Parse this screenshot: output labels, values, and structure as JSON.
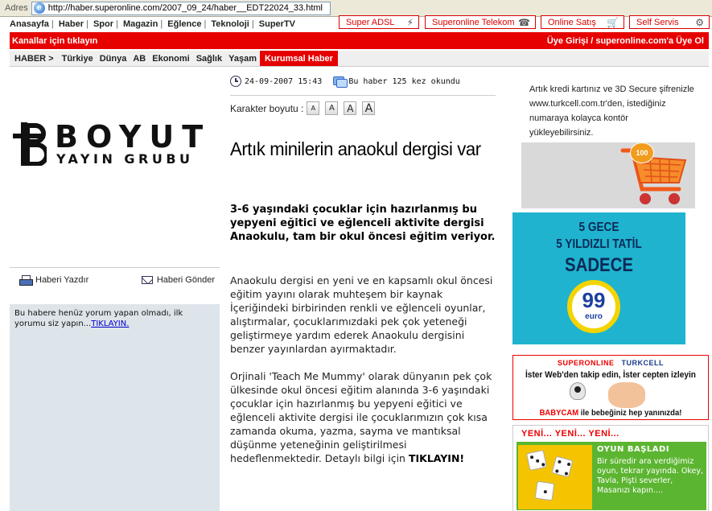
{
  "browser": {
    "address_label": "Adres",
    "url": "http://haber.superonline.com/2007_09_24/haber__EDT22024_33.html"
  },
  "service_tabs": [
    {
      "label": "Super ADSL",
      "icon": "lightning-icon"
    },
    {
      "label": "Superonline Telekom",
      "icon": "phone-icon"
    },
    {
      "label": "Online Satış",
      "icon": "cart-icon"
    },
    {
      "label": "Self Servis",
      "icon": "gear-icon"
    }
  ],
  "main_nav": [
    "Anasayfa",
    "Haber",
    "Spor",
    "Magazin",
    "Eğlence",
    "Teknoloji",
    "SuperTV"
  ],
  "red_bar": {
    "left": "Kanallar için tıklayın",
    "right": "Üye Girişi / superonline.com'a Üye Ol"
  },
  "sub_nav": {
    "head": "HABER >",
    "items": [
      "Türkiye",
      "Dünya",
      "AB",
      "Ekonomi",
      "Sağlık",
      "Yaşam"
    ],
    "active": "Kurumsal Haber"
  },
  "logo": {
    "line1": "BOYUT",
    "line2": "YAYIN GRUBU"
  },
  "tools": {
    "print": "Haberi Yazdır",
    "send": "Haberi Gönder"
  },
  "comments": {
    "text": "Bu habere henüz yorum yapan olmadı, ilk yorumu siz yapın...",
    "link": "TIKLAYIN."
  },
  "article": {
    "date": "24-09-2007 15:43",
    "views": "Bu haber 125 kez okundu",
    "font_size_label": "Karakter boyutu :",
    "font_buttons": [
      "A",
      "A",
      "A",
      "A"
    ],
    "title": "Artık minilerin anaokul dergisi var",
    "lead": "3-6 yaşındaki çocuklar için hazırlanmış bu yepyeni eğitici ve eğlenceli aktivite dergisi Anaokulu, tam bir okul öncesi eğitim veriyor.",
    "p1": "Anaokulu dergisi en yeni ve en kapsamlı okul öncesi eğitim yayını olarak muhteşem bir kaynak İçeriğindeki birbirinden renkli ve eğlenceli oyunlar, alıştırmalar, çocuklarımızdaki pek çok yeteneği geliştirmeye yardım ederek Anaokulu dergisini benzer yayınlardan ayırmaktadır.",
    "p2": "Orjinali 'Teach Me Mummy' olarak dünyanın pek çok ülkesinde okul öncesi eğitim alanında 3-6 yaşındaki çocuklar için hazırlanmış bu yepyeni eğitici ve eğlenceli aktivite dergisi ile çocuklarımızın çok kısa zamanda okuma, yazma, sayma ve mantıksal düşünme yeteneğinin geliştirilmesi hedeflenmektedir. Detaylı bilgi için",
    "p2_link": "TIKLAYIN!"
  },
  "ads": {
    "turkcell_text": "Artık kredi kartınız ve 3D Secure şifrenizle www.turkcell.com.tr'den, istediğiniz numaraya kolayca kontör yükleyebilirsiniz.",
    "badge": "100",
    "tatil_l1": "5 GECE",
    "tatil_l2": "5 YILDIZLI TATİL",
    "tatil_l3": "SADECE",
    "tatil_price": "99",
    "tatil_unit": "euro",
    "sol_brand1": "SUPERONLINE",
    "sol_brand2": "TURKCELL",
    "sol_slogan": "İster Web'den takip edin, İster cepten izleyin",
    "sol_bottom1": "BABYCAM",
    "sol_bottom2": "ile bebeğiniz hep yanınızda!",
    "yeni_head": "YENİ... YENİ... YENİ...",
    "yeni_title": "OYUN BAŞLADI",
    "yeni_text": "Bir süredir ara verdiğimiz oyun, tekrar yayında. Okey, Tavla, Pişti severler, Masanızı kapın...."
  },
  "colors": {
    "accent_red": "#e60000",
    "comment_bg": "#dde5ea",
    "ad_cyan": "#1fb3cf",
    "ad_green": "#5cb531"
  }
}
